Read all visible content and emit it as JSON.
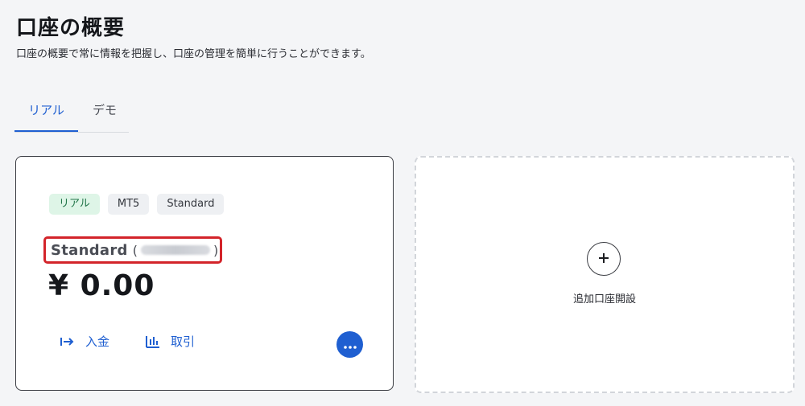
{
  "header": {
    "title": "口座の概要",
    "subtitle": "口座の概要で常に情報を把握し、口座の管理を簡単に行うことができます。"
  },
  "tabs": [
    {
      "label": "リアル",
      "active": true
    },
    {
      "label": "デモ",
      "active": false
    }
  ],
  "account": {
    "badges": [
      "リアル",
      "MT5",
      "Standard"
    ],
    "name": "Standard",
    "paren_open": "(",
    "paren_close": ")",
    "balance": "¥ 0.00",
    "actions": {
      "deposit_label": "入金",
      "trade_label": "取引"
    }
  },
  "add_account": {
    "label": "追加口座開設"
  },
  "colors": {
    "accent": "#1f5fd1",
    "highlight_border": "#d3242a",
    "real_badge_bg": "#def5e7"
  },
  "icons": {
    "deposit": "arrow-right-bar-icon",
    "trade": "chart-bars-icon",
    "more": "ellipsis-icon",
    "add": "plus-icon"
  }
}
